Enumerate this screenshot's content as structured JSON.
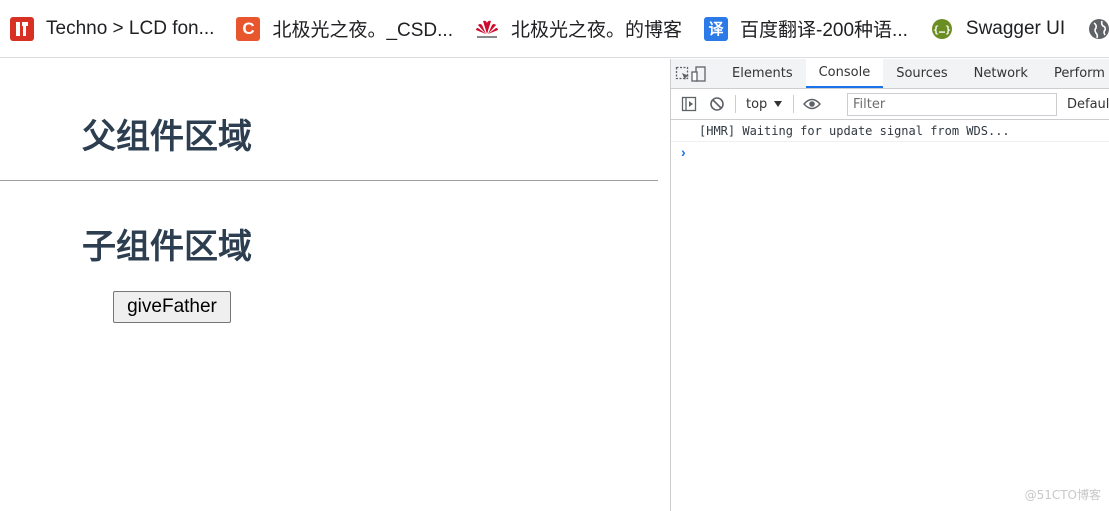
{
  "bookmarks": [
    {
      "label": "Techno > LCD fon...",
      "icon": "font-site-icon",
      "color": "#d93025"
    },
    {
      "label": "北极光之夜。_CSD...",
      "icon": "csdn-icon",
      "color": "#e8562d"
    },
    {
      "label": "北极光之夜。的博客",
      "icon": "huawei-icon",
      "color": "#cf0a2c"
    },
    {
      "label": "百度翻译-200种语...",
      "icon": "baidu-translate-icon",
      "color": "#2b7ae8",
      "glyph": "译"
    },
    {
      "label": "Swagger UI",
      "icon": "swagger-icon",
      "color": "#6b8e23"
    }
  ],
  "page": {
    "parent_heading": "父组件区域",
    "child_heading": "子组件区域",
    "button_label": "giveFather"
  },
  "devtools": {
    "tabs": [
      "Elements",
      "Console",
      "Sources",
      "Network",
      "Perform"
    ],
    "active_tab": "Console",
    "context": "top",
    "filter_placeholder": "Filter",
    "levels": "Default",
    "messages": [
      "[HMR] Waiting for update signal from WDS..."
    ],
    "prompt_symbol": "›"
  },
  "watermark": "@51CTO博客"
}
